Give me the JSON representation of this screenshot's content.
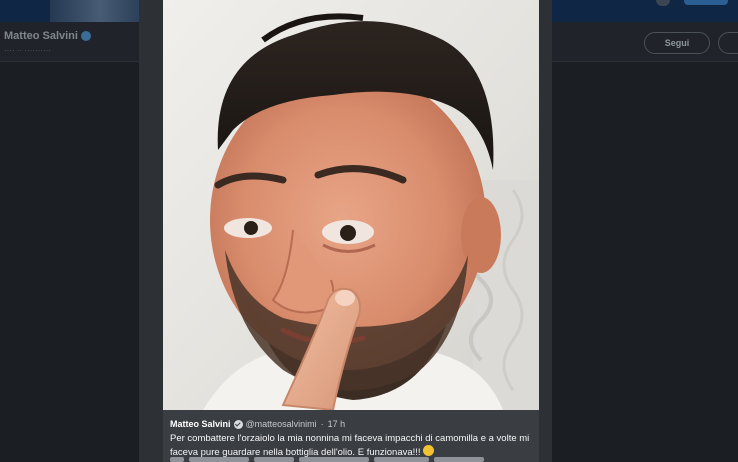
{
  "background": {
    "profile_name": "Matteo Salvini",
    "profile_subtitle": "···· ·· ··········",
    "follow_button": "Segui",
    "colors": {
      "overlay": "#1b1e22",
      "topbar": "#0f2744"
    }
  },
  "tweet": {
    "author_name": "Matteo Salvini",
    "verified_icon": "verified-badge-icon",
    "handle": "@matteosalvinimi",
    "separator": "·",
    "time": "17 h",
    "text_line_1": "Per combattere l'orzaiolo la mia nonnina mi faceva impacchi di camomilla e a volte mi",
    "text_line_2": "faceva pure guardare nella bottiglia dell'olio. E funzionava!!!",
    "emoji": "winking-face-emoji",
    "accent_color": "#f2c230"
  }
}
